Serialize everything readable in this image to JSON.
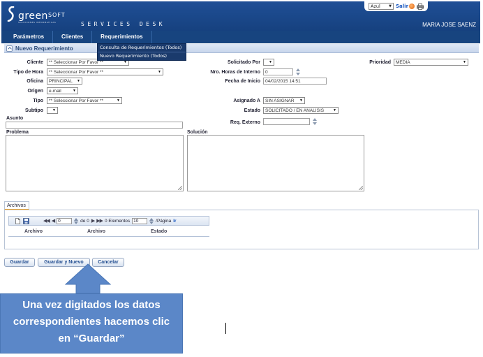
{
  "header": {
    "logo_text_main": "greenSOFT",
    "logo_word_a": "green",
    "logo_word_b": "SOFT",
    "logo_tagline": "SOLUCIONES INFORMATICAS",
    "app_title": "SERVICES DESK",
    "user_name": "MARIA JOSE SAENZ",
    "theme_value": "Azul",
    "logout_label": "Salir",
    "brand_color": "#1f4f96"
  },
  "menu": {
    "items": [
      "Parámetros",
      "Clientes",
      "Requerimientos"
    ],
    "dropdown": [
      "Consulta de Requerimientos (Todos)",
      "Nuevo Requerimiento (Todos)"
    ]
  },
  "section": {
    "title": "Nuevo Requerimiento"
  },
  "form": {
    "cliente": {
      "label": "Cliente",
      "value": "** Seleccionar Por Favor **"
    },
    "tipo_hora": {
      "label": "Tipo de Hora",
      "value": "** Seleccionar Por Favor **"
    },
    "oficina": {
      "label": "Oficina",
      "value": "PRINCIPAL"
    },
    "origen": {
      "label": "Origen",
      "value": "e-mail"
    },
    "tipo": {
      "label": "Tipo",
      "value": "** Seleccionar Por Favor **"
    },
    "subtipo": {
      "label": "Subtipo",
      "value": ""
    },
    "asunto": {
      "label": "Asunto",
      "value": ""
    },
    "problema": {
      "label": "Problema"
    },
    "solicitado_por": {
      "label": "Solicitado Por",
      "value": ""
    },
    "horas_interno": {
      "label": "Nro. Horas de Interno",
      "value": "0"
    },
    "fecha_inicio": {
      "label": "Fecha de Inicio",
      "value": "04/02/2015 14:51"
    },
    "asignado_a": {
      "label": "Asignado A",
      "value": "SIN ASIGNAR"
    },
    "estado": {
      "label": "Estado",
      "value": "SOLICITADO / EN ANALISIS"
    },
    "req_externo": {
      "label": "Req. Externo",
      "value": ""
    },
    "solucion": {
      "label": "Solución"
    },
    "prioridad": {
      "label": "Prioridad",
      "value": "MEDIA"
    }
  },
  "files": {
    "tab_label": "Archivos",
    "page_value": "0",
    "of_label": "de 0",
    "elements_label": "0 Elementos",
    "page_size": "10",
    "per_page_label": "/Página",
    "go_label": "Ir",
    "columns": [
      "Archivo",
      "Archivo",
      "Estado"
    ]
  },
  "buttons": {
    "save": "Guardar",
    "save_new": "Guardar y Nuevo",
    "cancel": "Cancelar"
  },
  "callout": {
    "line1": "Una vez digitados los datos",
    "line2": "correspondientes hacemos clic",
    "line3": "en “Guardar”",
    "color": "#5b87c8"
  }
}
